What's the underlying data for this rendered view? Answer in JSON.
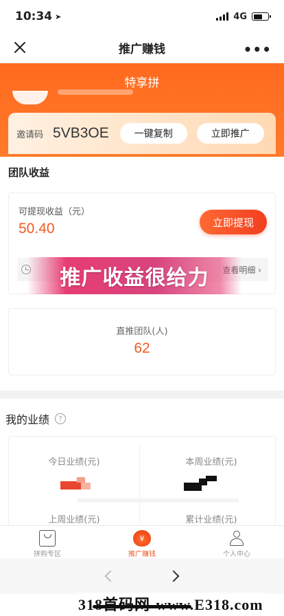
{
  "status_bar": {
    "time": "10:34",
    "network": "4G"
  },
  "nav": {
    "title": "推广赚钱"
  },
  "banner": {
    "title": "特享拼"
  },
  "invite": {
    "label": "邀请码",
    "code": "5VB3OE",
    "copy_label": "一键复制",
    "promote_label": "立即推广"
  },
  "team_earnings": {
    "section_title": "团队收益",
    "withdrawable_label": "可提现收益（元）",
    "withdrawable_value": "50.40",
    "withdraw_button": "立即提现",
    "detail_link": "查看明细",
    "overlay_text": "推广收益很给力"
  },
  "team": {
    "label": "直推团队(人)",
    "value": "62"
  },
  "performance": {
    "section_title": "我的业绩",
    "today_label": "今日业绩(元)",
    "week_label": "本周业绩(元)",
    "last_week_label": "上周业绩(元)",
    "total_label": "累计业绩(元)"
  },
  "tabs": [
    {
      "label": "拼购专区",
      "icon": "shopping-bag-icon"
    },
    {
      "label": "推广赚钱",
      "icon": "money-bag-icon"
    },
    {
      "label": "个人中心",
      "icon": "user-icon"
    }
  ],
  "watermark": "318首码网-www.E318.com",
  "colors": {
    "accent": "#f15a24",
    "banner": "#ff6a1f",
    "overlay": "#d8447e"
  }
}
